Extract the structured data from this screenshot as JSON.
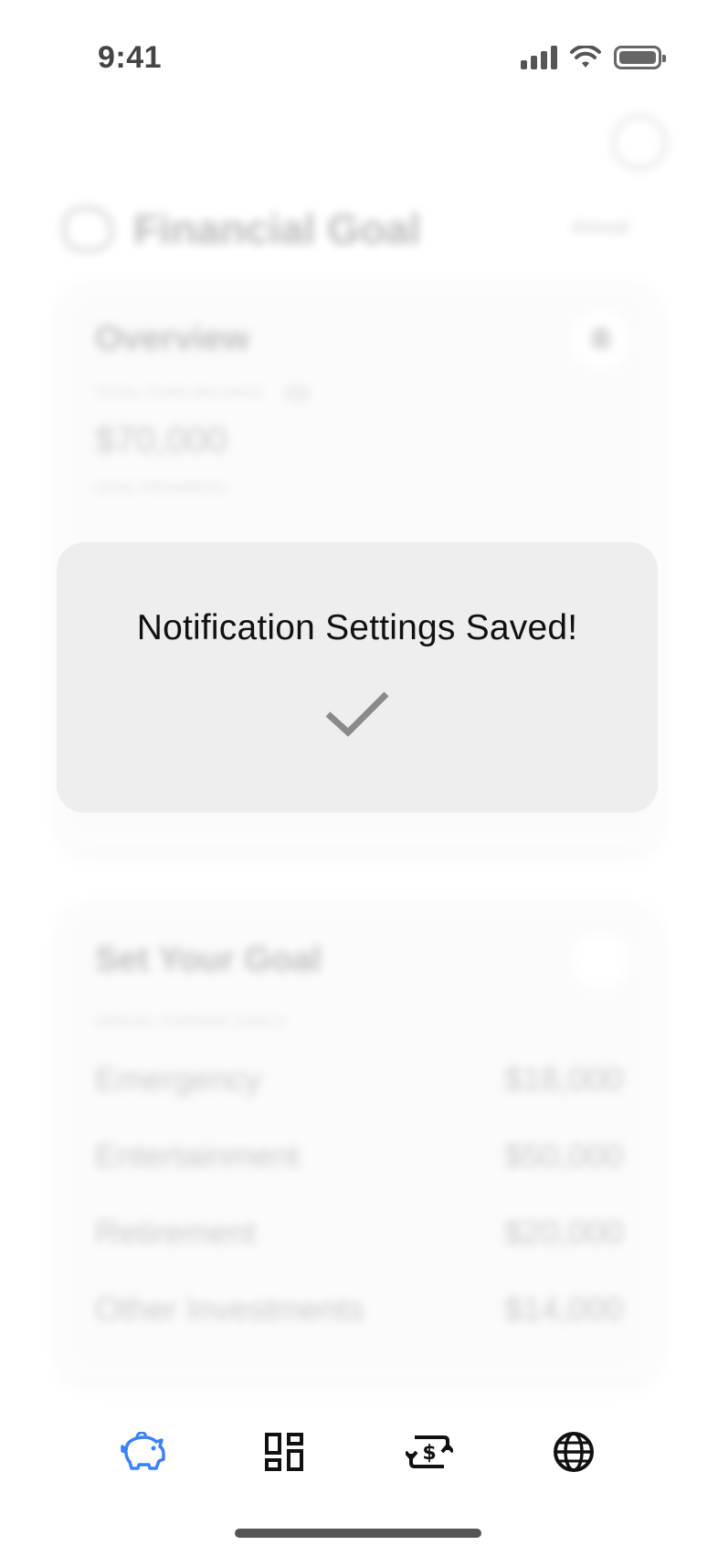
{
  "status_bar": {
    "time": "9:41"
  },
  "header": {
    "title": "Financial Goal",
    "period": "Annual"
  },
  "overview": {
    "title": "Overview",
    "balance_label": "TOTAL FUND BALANCE",
    "balance_value": "$70,000",
    "progress_label": "GOAL PROGRESS"
  },
  "set_goal": {
    "title": "Set Your Goal",
    "section_label": "ANNUAL FUNDING GOALS",
    "rows": [
      {
        "label": "Emergency",
        "value": "$18,000"
      },
      {
        "label": "Entertainment",
        "value": "$50,000"
      },
      {
        "label": "Retirement",
        "value": "$20,000"
      },
      {
        "label": "Other Investments",
        "value": "$14,000"
      }
    ]
  },
  "toast": {
    "message": "Notification Settings Saved!"
  },
  "tabs": [
    {
      "icon": "piggy-bank-icon",
      "active": true
    },
    {
      "icon": "dashboard-grid-icon",
      "active": false
    },
    {
      "icon": "currency-exchange-icon",
      "active": false
    },
    {
      "icon": "globe-icon",
      "active": false
    }
  ],
  "colors": {
    "accent": "#3b82f6",
    "toast_bg": "#eeeeee",
    "check": "#8a8a8a",
    "icon_dark": "#111111"
  }
}
